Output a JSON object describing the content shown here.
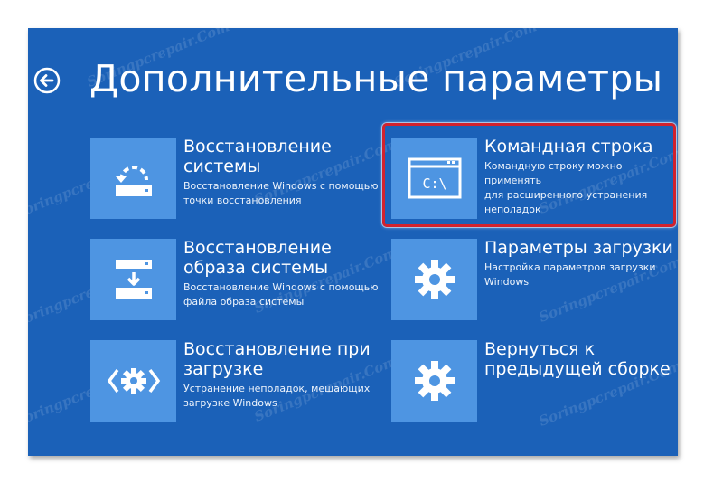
{
  "header": {
    "title": "Дополнительные параметры",
    "back_icon": "back-arrow-icon"
  },
  "options": [
    {
      "id": "system-restore",
      "title_line1": "Восстановление",
      "title_line2": "системы",
      "desc_line1": "Восстановление Windows с помощью",
      "desc_line2": "точки восстановления",
      "icon": "system-restore-icon"
    },
    {
      "id": "command-prompt",
      "title_line1": "Командная строка",
      "title_line2": "",
      "desc_line1": "Командную строку можно применять",
      "desc_line2": "для расширенного устранения",
      "desc_line3": "неполадок",
      "icon": "command-prompt-icon",
      "icon_text": "C:\\"
    },
    {
      "id": "image-recovery",
      "title_line1": "Восстановление",
      "title_line2": "образа системы",
      "desc_line1": "Восстановление Windows с помощью",
      "desc_line2": "файла образа системы",
      "icon": "image-recovery-icon"
    },
    {
      "id": "startup-settings",
      "title_line1": "Параметры загрузки",
      "title_line2": "",
      "desc_line1": "Настройка параметров загрузки",
      "desc_line2": "Windows",
      "icon": "gear-icon"
    },
    {
      "id": "startup-repair",
      "title_line1": "Восстановление при",
      "title_line2": "загрузке",
      "desc_line1": "Устранение неполадок, мешающих",
      "desc_line2": "загрузке Windows",
      "icon": "startup-repair-icon"
    },
    {
      "id": "previous-build",
      "title_line1": "Вернуться к",
      "title_line2": "предыдущей сборке",
      "desc_line1": "",
      "desc_line2": "",
      "icon": "gear-icon"
    }
  ],
  "watermark": "Soringpcrepair.Com",
  "colors": {
    "background": "#1b61b8",
    "tile_icon": "#4e95e2",
    "highlight": "#d2222d",
    "text": "#ffffff"
  }
}
